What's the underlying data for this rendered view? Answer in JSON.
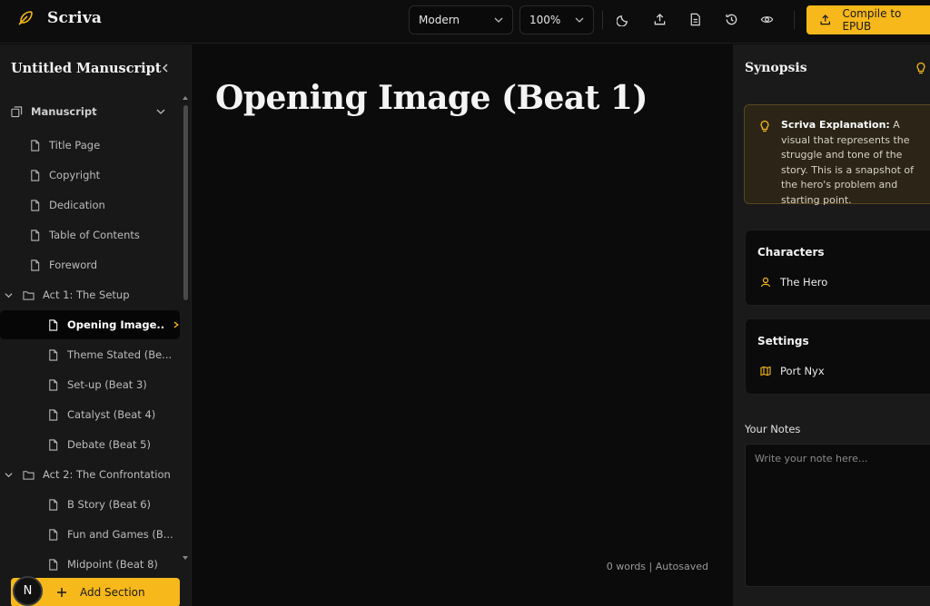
{
  "app": {
    "name": "Scriva"
  },
  "toolbar": {
    "theme_select": "Modern",
    "zoom_select": "100%",
    "compile_label": "Compile to EPUB"
  },
  "sidebar": {
    "title": "Untitled Manuscript",
    "root_label": "Manuscript",
    "items": [
      {
        "label": "Title Page",
        "type": "page"
      },
      {
        "label": "Copyright",
        "type": "page"
      },
      {
        "label": "Dedication",
        "type": "page"
      },
      {
        "label": "Table of Contents",
        "type": "page"
      },
      {
        "label": "Foreword",
        "type": "page"
      },
      {
        "label": "Act 1: The Setup",
        "type": "folder"
      },
      {
        "label": "Opening Image...",
        "type": "page",
        "active": true
      },
      {
        "label": "Theme Stated (Be...",
        "type": "page"
      },
      {
        "label": "Set-up (Beat 3)",
        "type": "page"
      },
      {
        "label": "Catalyst (Beat 4)",
        "type": "page"
      },
      {
        "label": "Debate (Beat 5)",
        "type": "page"
      },
      {
        "label": "Act 2: The Confrontation",
        "type": "folder"
      },
      {
        "label": "B Story (Beat 6)",
        "type": "page"
      },
      {
        "label": "Fun and Games (B...",
        "type": "page"
      },
      {
        "label": "Midpoint (Beat 8)",
        "type": "page"
      }
    ],
    "add_section_label": "Add Section",
    "avatar_letter": "N"
  },
  "editor": {
    "title": "Opening Image (Beat 1)",
    "status": "0 words | Autosaved"
  },
  "right_panel": {
    "title": "Synopsis",
    "explanation_label": "Scriva Explanation:",
    "explanation_text": " A visual that represents the struggle and tone of the story. This is a snapshot of the hero's problem and starting point.",
    "characters_heading": "Characters",
    "character": "The Hero",
    "settings_heading": "Settings",
    "setting": "Port Nyx",
    "notes_label": "Your Notes",
    "notes_placeholder": "Write your note here..."
  },
  "colors": {
    "accent": "#f6b81a",
    "background": "#0b0b0b",
    "sidebar": "#181818"
  }
}
